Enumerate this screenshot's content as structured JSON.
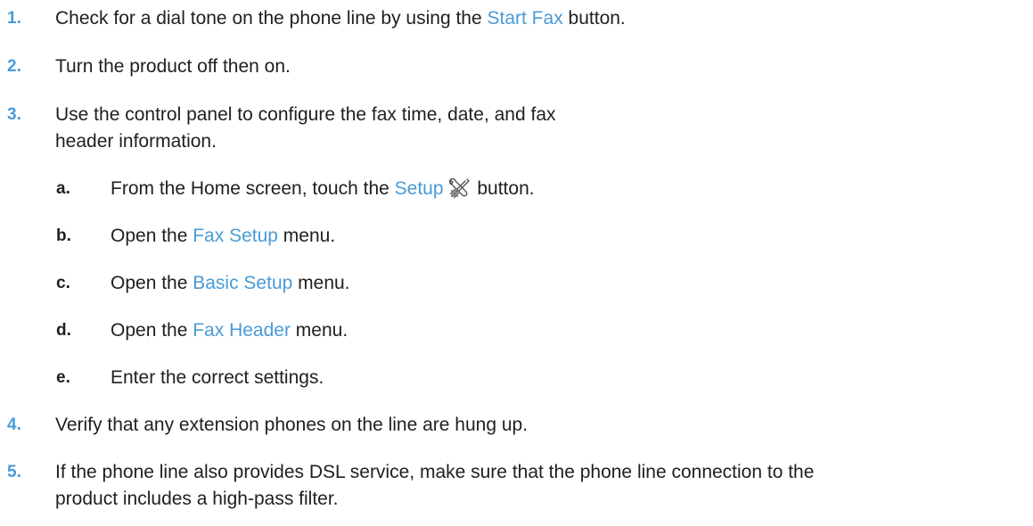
{
  "steps": [
    {
      "number": "1.",
      "pre": "Check for a dial tone on the phone line by using the ",
      "link": "Start Fax",
      "post": " button."
    },
    {
      "number": "2.",
      "text": "Turn the product off then on."
    },
    {
      "number": "3.",
      "line1": "Use the control panel to configure the fax time, date, and fax",
      "line2": "header information."
    },
    {
      "number": "4.",
      "text": "Verify that any extension phones on the line are hung up."
    },
    {
      "number": "5.",
      "line1": "If the phone line also provides DSL service, make sure that the phone line connection to the",
      "line2": "product includes a high-pass filter."
    }
  ],
  "substeps": [
    {
      "letter": "a.",
      "pre": "From the Home screen, touch the ",
      "link": "Setup",
      "icon": "setup-wrench-gear-icon",
      "post": " button."
    },
    {
      "letter": "b.",
      "pre": "Open the ",
      "link": "Fax Setup",
      "post": " menu."
    },
    {
      "letter": "c.",
      "pre": "Open the ",
      "link": "Basic Setup",
      "post": " menu."
    },
    {
      "letter": "d.",
      "pre": "Open the ",
      "link": "Fax Header",
      "post": " menu."
    },
    {
      "letter": "e.",
      "text": "Enter the correct settings."
    }
  ],
  "colors": {
    "link": "#4a9bd6",
    "step_number": "#4a9bd6",
    "text": "#1f1f1f"
  }
}
